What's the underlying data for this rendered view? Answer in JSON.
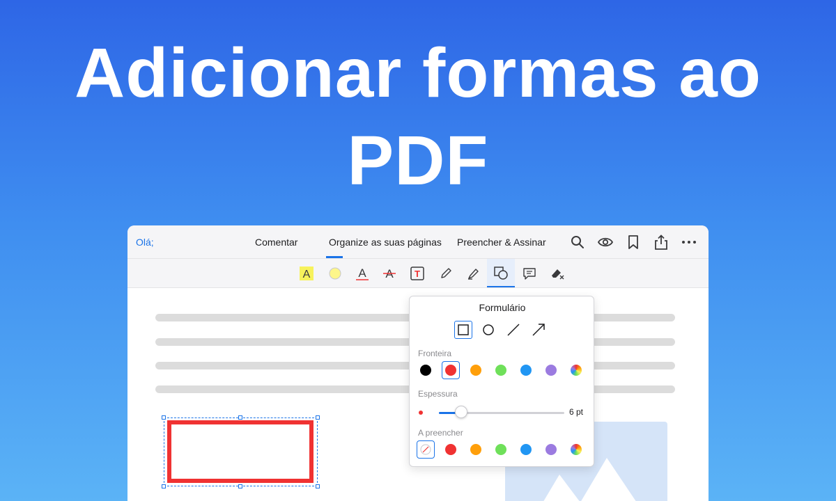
{
  "hero": {
    "line1": "Adicionar formas ao",
    "line2": "PDF"
  },
  "topbar": {
    "back_label": "Olá;",
    "tabs": [
      {
        "label": "Comentar"
      },
      {
        "label": "Organize as suas páginas",
        "active": true
      },
      {
        "label": "Preencher & Assinar"
      }
    ],
    "icons": [
      "search-icon",
      "eye-icon",
      "bookmark-icon",
      "share-icon",
      "more-icon"
    ]
  },
  "toolbar": {
    "tools": [
      "highlight-text-icon",
      "highlighter-color-icon",
      "underline-icon",
      "strikethrough-icon",
      "text-box-icon",
      "pencil-icon",
      "marker-icon",
      "shapes-icon",
      "comment-icon",
      "eraser-icon"
    ],
    "active_tool": "shapes-icon"
  },
  "popover": {
    "title": "Formulário",
    "shapes": [
      "rectangle-icon",
      "circle-icon",
      "line-icon",
      "arrow-icon"
    ],
    "selected_shape": "rectangle-icon",
    "border": {
      "label": "Fronteira",
      "colors": [
        "#000000",
        "#f03232",
        "#ff9f0a",
        "#6fe05a",
        "#2196f3",
        "#9b7be0",
        "multicolor"
      ],
      "selected": "#f03232"
    },
    "thickness": {
      "label": "Espessura",
      "value_text": "6 pt",
      "fraction": 0.18
    },
    "fill": {
      "label": "A preencher",
      "colors": [
        "none",
        "#f03232",
        "#ff9f0a",
        "#6fe05a",
        "#2196f3",
        "#9b7be0",
        "multicolor"
      ],
      "selected": "none"
    }
  },
  "document": {
    "shape_border_color": "#f03232"
  },
  "colors": {
    "accent": "#1a73e8"
  }
}
